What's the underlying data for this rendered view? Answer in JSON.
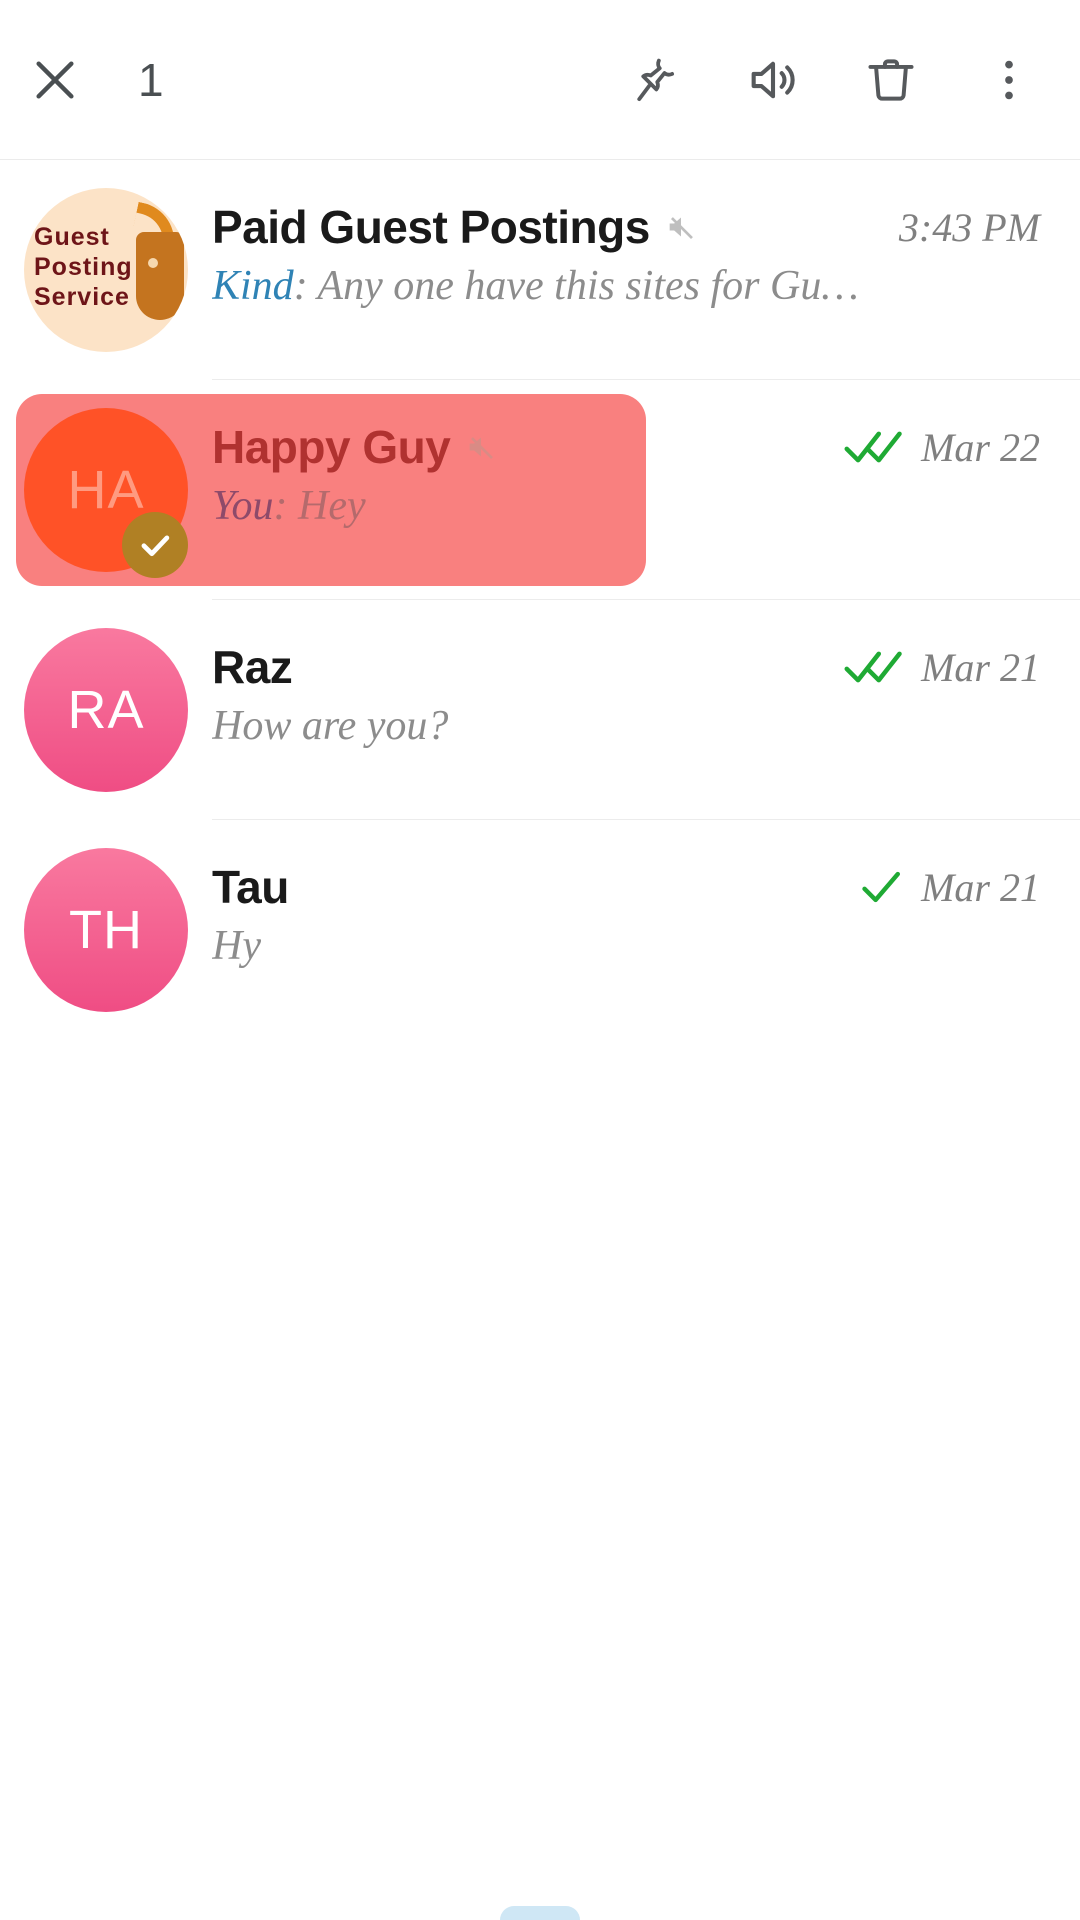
{
  "toolbar": {
    "close_icon": "close-icon",
    "selected_count": "1",
    "pin_icon": "pin-icon",
    "unmute_icon": "speaker-volume-icon",
    "delete_icon": "trash-icon",
    "more_icon": "more-vertical-icon"
  },
  "colors": {
    "selection_highlight": "#f9807f",
    "selected_title": "#b03230",
    "tick_green": "#1faa34",
    "sender_blue": "#2f83b5",
    "badge_gold": "#b08024",
    "avatar_orange": "#ff5227",
    "avatar_pink": "#ef4d84",
    "avatar_cream": "#fce3c7"
  },
  "chats": [
    {
      "avatar_type": "image",
      "avatar_initials": "",
      "avatar_logo_lines": [
        "Guest",
        "Posting",
        "Service"
      ],
      "avatar_class": "gps",
      "title": "Paid Guest Postings",
      "muted": true,
      "sender": "Kind",
      "preview": "Any one have this sites for Gu…",
      "ticks": "none",
      "time": "3:43 PM",
      "selected": false
    },
    {
      "avatar_type": "initials",
      "avatar_initials": "HA",
      "avatar_class": "ha",
      "title": "Happy Guy",
      "muted": true,
      "sender": "You",
      "preview": "Hey",
      "ticks": "double",
      "time": "Mar 22",
      "selected": true
    },
    {
      "avatar_type": "initials",
      "avatar_initials": "RA",
      "avatar_class": "ra",
      "title": "Raz",
      "muted": false,
      "sender": "",
      "preview": "How are you?",
      "ticks": "double",
      "time": "Mar 21",
      "selected": false
    },
    {
      "avatar_type": "initials",
      "avatar_initials": "TH",
      "avatar_class": "th",
      "title": "Tau",
      "muted": false,
      "sender": "",
      "preview": "Hy",
      "ticks": "single",
      "time": "Mar 21",
      "selected": false
    }
  ]
}
